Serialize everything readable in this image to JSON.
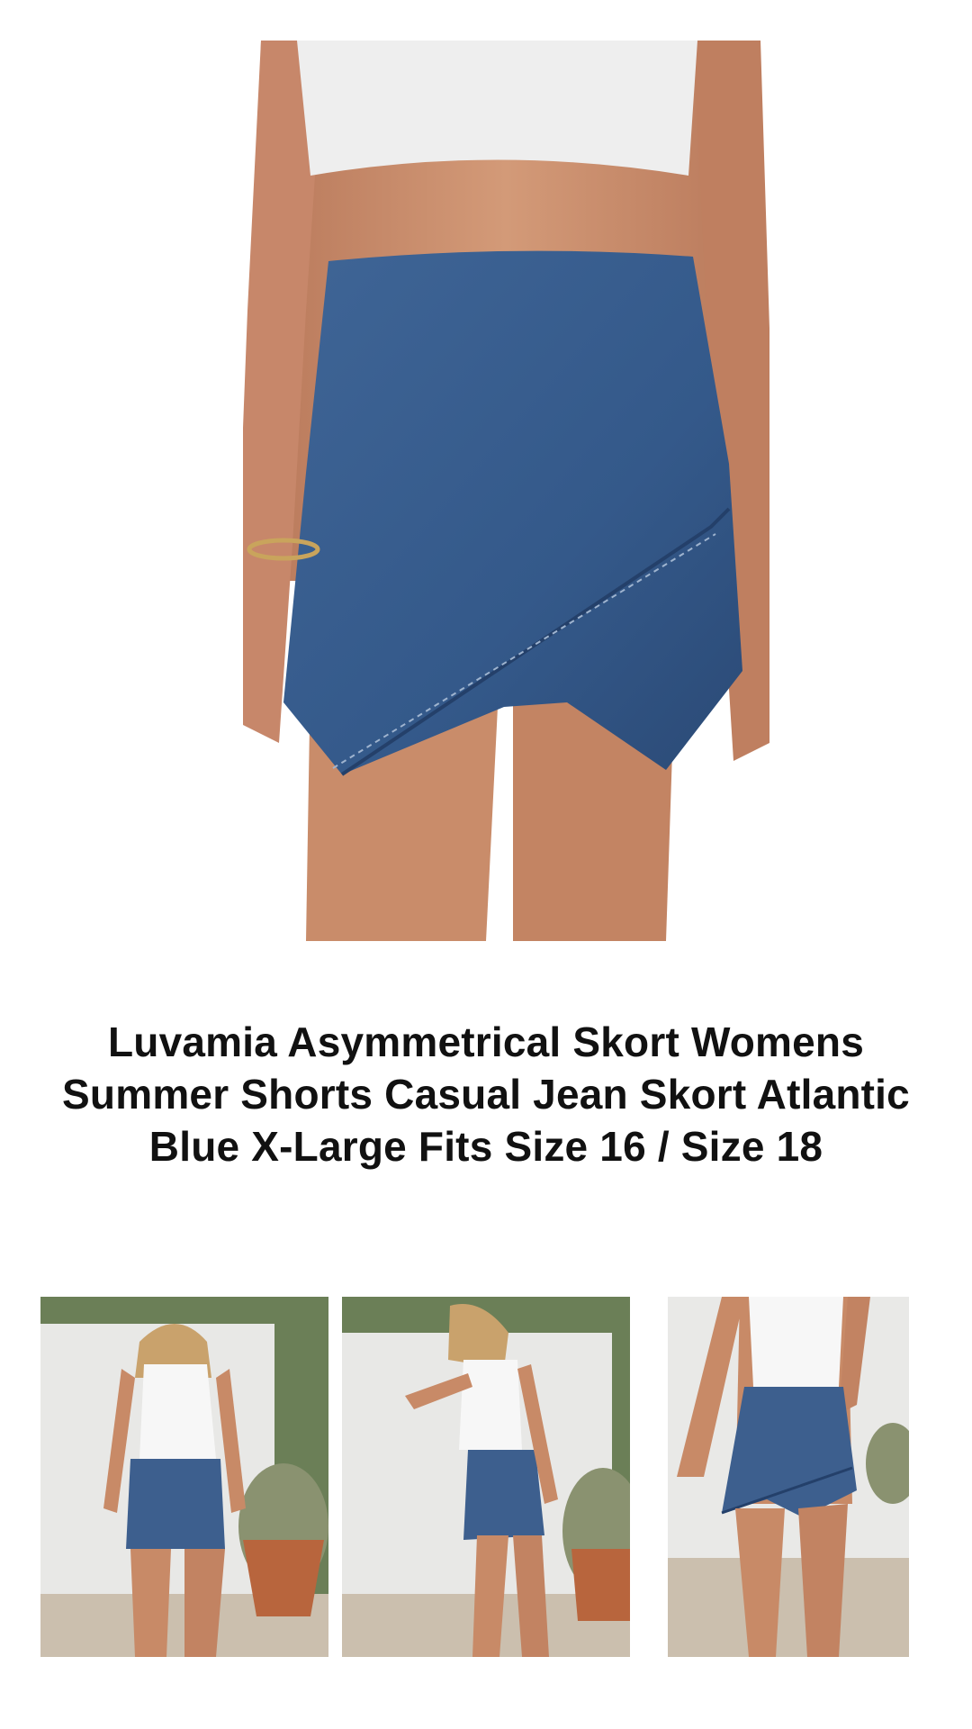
{
  "product": {
    "title": "Luvamia Asymmetrical Skort Womens Summer Shorts Casual Jean Skort Atlantic Blue X-Large Fits Size 16 / Size 18"
  },
  "images": {
    "hero": "product-hero-image",
    "thumbnails": [
      "thumbnail-back-view",
      "thumbnail-side-view",
      "thumbnail-front-closeup"
    ]
  },
  "colors": {
    "denim": "#3b5f8f",
    "denim_dark": "#2c4a73",
    "skin": "#c88a67",
    "top": "#eeeeee",
    "wall": "#e8e8e6"
  }
}
